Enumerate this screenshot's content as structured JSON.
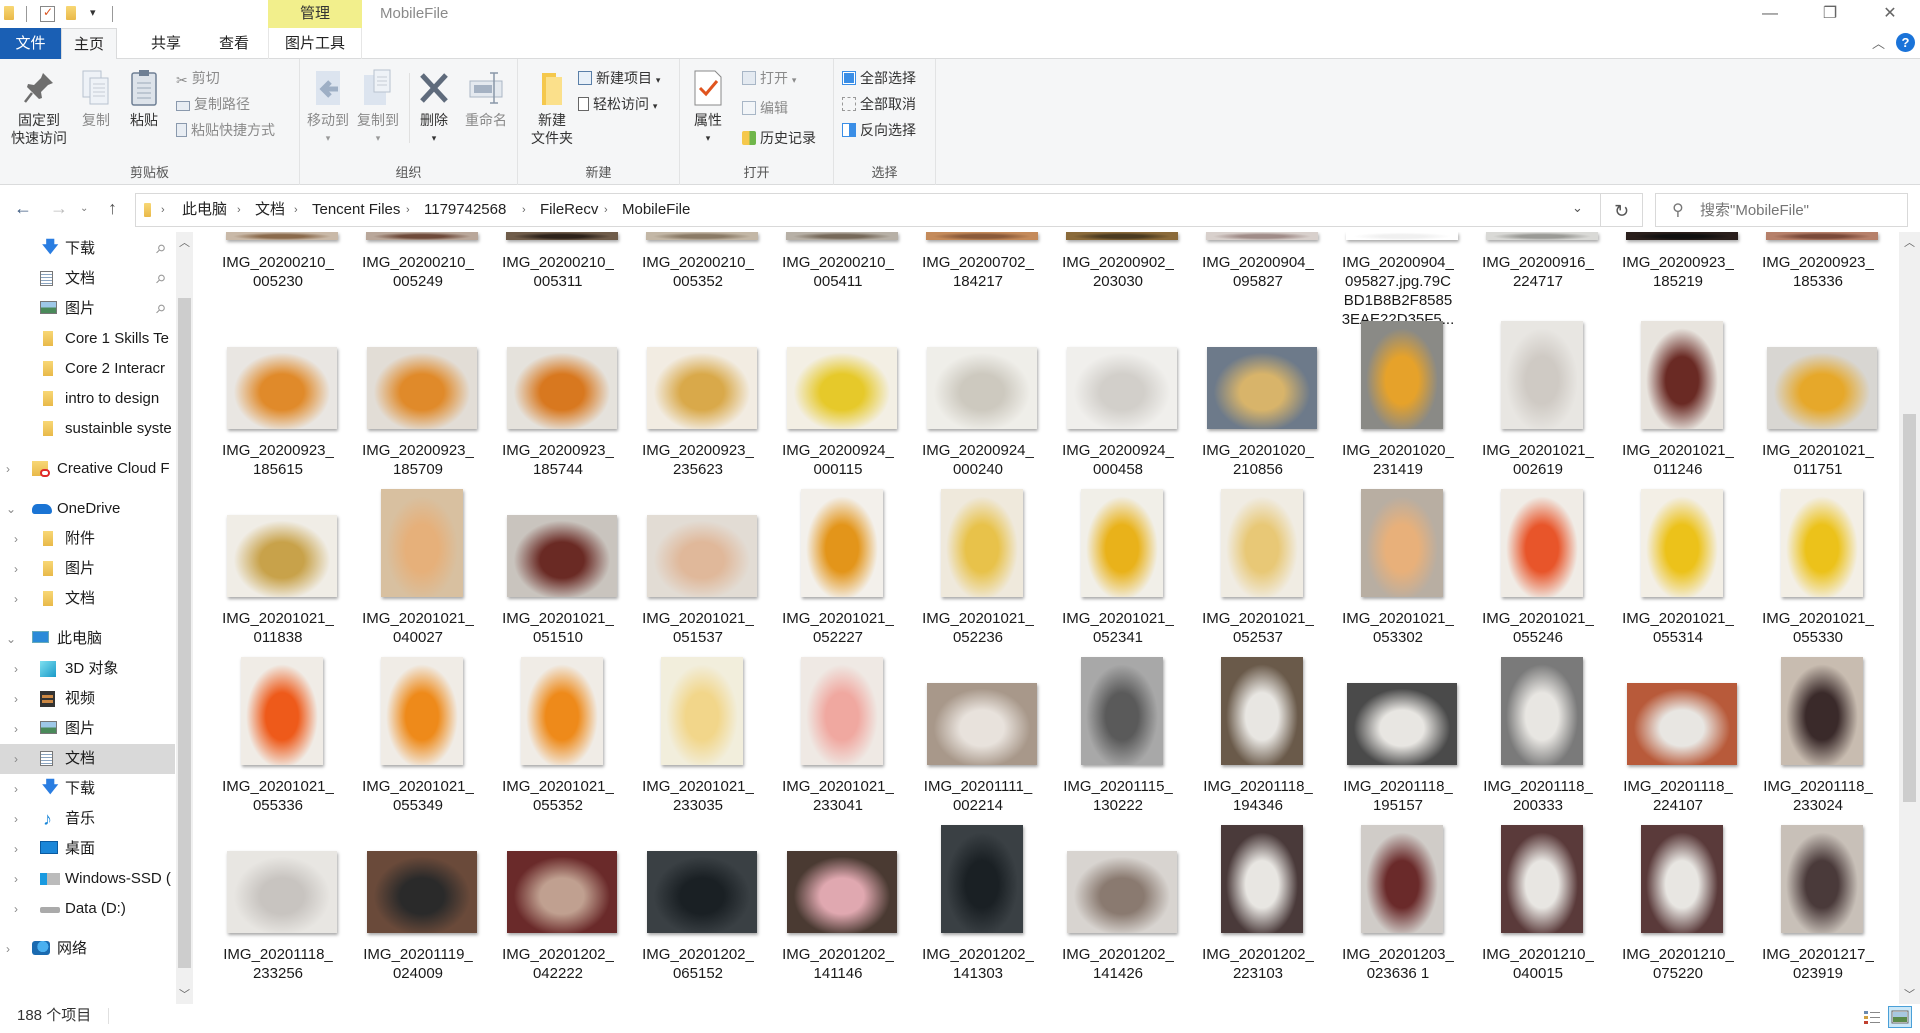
{
  "window": {
    "title": "MobileFile",
    "manage_tab": "管理",
    "min_glyph": "—",
    "max_glyph": "❐",
    "close_glyph": "✕"
  },
  "tabs": {
    "file": "文件",
    "home": "主页",
    "share": "共享",
    "view": "查看",
    "picture_tools": "图片工具"
  },
  "ribbon": {
    "clipboard": {
      "label": "剪贴板",
      "pin_line1": "固定到",
      "pin_line2": "快速访问",
      "copy": "复制",
      "paste": "粘贴",
      "cut": "剪切",
      "copy_path": "复制路径",
      "paste_shortcut": "粘贴快捷方式"
    },
    "organize": {
      "label": "组织",
      "move_to": "移动到",
      "copy_to": "复制到",
      "delete": "删除",
      "rename": "重命名"
    },
    "new": {
      "label": "新建",
      "new_folder_line1": "新建",
      "new_folder_line2": "文件夹",
      "new_item": "新建项目",
      "easy_access": "轻松访问"
    },
    "open": {
      "label": "打开",
      "properties": "属性",
      "open": "打开",
      "edit": "编辑",
      "history": "历史记录"
    },
    "select": {
      "label": "选择",
      "select_all": "全部选择",
      "select_none": "全部取消",
      "invert": "反向选择"
    }
  },
  "address": {
    "breadcrumbs": [
      "此电脑",
      "文档",
      "Tencent Files",
      "1179742568",
      "FileRecv",
      "MobileFile"
    ],
    "search_placeholder": "搜索\"MobileFile\""
  },
  "sidebar": {
    "items": [
      {
        "label": "下载",
        "icon": "download-icon",
        "pinned": true
      },
      {
        "label": "文档",
        "icon": "documents-icon",
        "pinned": true
      },
      {
        "label": "图片",
        "icon": "pictures-icon",
        "pinned": true
      },
      {
        "label": "Core 1 Skills Te",
        "icon": "folder-icon"
      },
      {
        "label": "Core 2 Interacr",
        "icon": "folder-icon"
      },
      {
        "label": "intro to design",
        "icon": "folder-icon"
      },
      {
        "label": "sustainble syste",
        "icon": "folder-icon"
      },
      {
        "label": "Creative Cloud F",
        "icon": "creative-cloud-icon"
      },
      {
        "label": "OneDrive",
        "icon": "onedrive-icon"
      },
      {
        "label": "附件",
        "icon": "folder-icon"
      },
      {
        "label": "图片",
        "icon": "folder-icon"
      },
      {
        "label": "文档",
        "icon": "folder-icon"
      },
      {
        "label": "此电脑",
        "icon": "this-pc-icon"
      },
      {
        "label": "3D 对象",
        "icon": "3d-objects-icon"
      },
      {
        "label": "视频",
        "icon": "videos-icon"
      },
      {
        "label": "图片",
        "icon": "pictures-icon"
      },
      {
        "label": "文档",
        "icon": "documents-icon",
        "selected": true
      },
      {
        "label": "下载",
        "icon": "download-icon"
      },
      {
        "label": "音乐",
        "icon": "music-icon"
      },
      {
        "label": "桌面",
        "icon": "desktop-icon"
      },
      {
        "label": "Windows-SSD (",
        "icon": "windows-drive-icon"
      },
      {
        "label": "Data (D:)",
        "icon": "drive-icon"
      },
      {
        "label": "网络",
        "icon": "network-icon"
      }
    ]
  },
  "files": [
    {
      "l1": "IMG_20200210_",
      "l2": "005230"
    },
    {
      "l1": "IMG_20200210_",
      "l2": "005249"
    },
    {
      "l1": "IMG_20200210_",
      "l2": "005311"
    },
    {
      "l1": "IMG_20200210_",
      "l2": "005352"
    },
    {
      "l1": "IMG_20200210_",
      "l2": "005411"
    },
    {
      "l1": "IMG_20200702_",
      "l2": "184217"
    },
    {
      "l1": "IMG_20200902_",
      "l2": "203030"
    },
    {
      "l1": "IMG_20200904_",
      "l2": "095827"
    },
    {
      "l1": "IMG_20200904_",
      "l2": "095827.jpg.79C",
      "l3": "BD1B8B2F8585",
      "l4": "3EAE22D35F5..."
    },
    {
      "l1": "IMG_20200916_",
      "l2": "224717"
    },
    {
      "l1": "IMG_20200923_",
      "l2": "185219"
    },
    {
      "l1": "IMG_20200923_",
      "l2": "185336"
    },
    {
      "l1": "IMG_20200923_",
      "l2": "185615"
    },
    {
      "l1": "IMG_20200923_",
      "l2": "185709"
    },
    {
      "l1": "IMG_20200923_",
      "l2": "185744"
    },
    {
      "l1": "IMG_20200923_",
      "l2": "235623"
    },
    {
      "l1": "IMG_20200924_",
      "l2": "000115"
    },
    {
      "l1": "IMG_20200924_",
      "l2": "000240"
    },
    {
      "l1": "IMG_20200924_",
      "l2": "000458"
    },
    {
      "l1": "IMG_20201020_",
      "l2": "210856"
    },
    {
      "l1": "IMG_20201020_",
      "l2": "231419"
    },
    {
      "l1": "IMG_20201021_",
      "l2": "002619"
    },
    {
      "l1": "IMG_20201021_",
      "l2": "011246"
    },
    {
      "l1": "IMG_20201021_",
      "l2": "011751"
    },
    {
      "l1": "IMG_20201021_",
      "l2": "011838"
    },
    {
      "l1": "IMG_20201021_",
      "l2": "040027"
    },
    {
      "l1": "IMG_20201021_",
      "l2": "051510"
    },
    {
      "l1": "IMG_20201021_",
      "l2": "051537"
    },
    {
      "l1": "IMG_20201021_",
      "l2": "052227"
    },
    {
      "l1": "IMG_20201021_",
      "l2": "052236"
    },
    {
      "l1": "IMG_20201021_",
      "l2": "052341"
    },
    {
      "l1": "IMG_20201021_",
      "l2": "052537"
    },
    {
      "l1": "IMG_20201021_",
      "l2": "053302"
    },
    {
      "l1": "IMG_20201021_",
      "l2": "055246"
    },
    {
      "l1": "IMG_20201021_",
      "l2": "055314"
    },
    {
      "l1": "IMG_20201021_",
      "l2": "055330"
    },
    {
      "l1": "IMG_20201021_",
      "l2": "055336"
    },
    {
      "l1": "IMG_20201021_",
      "l2": "055349"
    },
    {
      "l1": "IMG_20201021_",
      "l2": "055352"
    },
    {
      "l1": "IMG_20201021_",
      "l2": "233035"
    },
    {
      "l1": "IMG_20201021_",
      "l2": "233041"
    },
    {
      "l1": "IMG_20201111_",
      "l2": "002214"
    },
    {
      "l1": "IMG_20201115_",
      "l2": "130222"
    },
    {
      "l1": "IMG_20201118_",
      "l2": "194346"
    },
    {
      "l1": "IMG_20201118_",
      "l2": "195157"
    },
    {
      "l1": "IMG_20201118_",
      "l2": "200333"
    },
    {
      "l1": "IMG_20201118_",
      "l2": "224107"
    },
    {
      "l1": "IMG_20201118_",
      "l2": "233024"
    },
    {
      "l1": "IMG_20201118_",
      "l2": "233256"
    },
    {
      "l1": "IMG_20201119_",
      "l2": "024009"
    },
    {
      "l1": "IMG_20201202_",
      "l2": "042222"
    },
    {
      "l1": "IMG_20201202_",
      "l2": "065152"
    },
    {
      "l1": "IMG_20201202_",
      "l2": "141146"
    },
    {
      "l1": "IMG_20201202_",
      "l2": "141303"
    },
    {
      "l1": "IMG_20201202_",
      "l2": "141426"
    },
    {
      "l1": "IMG_20201202_",
      "l2": "223103"
    },
    {
      "l1": "IMG_20201203_",
      "l2": "023636 1"
    },
    {
      "l1": "IMG_20201210_",
      "l2": "040015"
    },
    {
      "l1": "IMG_20201210_",
      "l2": "075220"
    },
    {
      "l1": "IMG_20201217_",
      "l2": "023919"
    }
  ],
  "thumb_colors": [
    [
      "#c9b9a8",
      "#8a6a4c"
    ],
    [
      "#b9a79a",
      "#6e4a3a"
    ],
    [
      "#6f5c4a",
      "#2d221a"
    ],
    [
      "#c3b7a6",
      "#8a7a66"
    ],
    [
      "#b7b0a6",
      "#76695a"
    ],
    [
      "#c48a5a",
      "#8a5a3a"
    ],
    [
      "#8a6a3a",
      "#4a3a20"
    ],
    [
      "#d8d0cc",
      "#a08c88"
    ],
    [
      "#ffffff",
      "#f0f0f0"
    ],
    [
      "#d9d9d6",
      "#9a9a96"
    ],
    [
      "#2a1f1c",
      "#101010"
    ],
    [
      "#b6806a",
      "#7a4a3a"
    ],
    [
      "#e9e6e2",
      "#e08a2a"
    ],
    [
      "#e2ddd6",
      "#e08a2a"
    ],
    [
      "#e5e2dc",
      "#d8781f"
    ],
    [
      "#f2ece2",
      "#d9a94a"
    ],
    [
      "#f3efe4",
      "#e6c92a"
    ],
    [
      "#efeee9",
      "#cdc9bf"
    ],
    [
      "#f0efec",
      "#d2cfca"
    ],
    [
      "#6d7a8a",
      "#d8b46a"
    ],
    [
      "#8a8a86",
      "#e6a22a"
    ],
    [
      "#e8e6e2",
      "#cfcac4"
    ],
    [
      "#e8e4de",
      "#6a2a24"
    ],
    [
      "#d8d6d2",
      "#e6a82a"
    ],
    [
      "#f0ede6",
      "#c8a24a"
    ],
    [
      "#d8c0a0",
      "#e6b07a"
    ],
    [
      "#c9c4be",
      "#6a2a24"
    ],
    [
      "#e2dcd4",
      "#e0b89a"
    ],
    [
      "#f3f0eb",
      "#e3951a"
    ],
    [
      "#efe9dc",
      "#e8c24a"
    ],
    [
      "#f1efe8",
      "#e9b21a"
    ],
    [
      "#f0ece3",
      "#e8c876"
    ],
    [
      "#b8aea2",
      "#e8b07a"
    ],
    [
      "#f0ece6",
      "#e8552a"
    ],
    [
      "#f3efe6",
      "#ecc21a"
    ],
    [
      "#f3efe6",
      "#ecc21a"
    ],
    [
      "#f0ece6",
      "#ee5a1a"
    ],
    [
      "#f0ece6",
      "#ee8a1a"
    ],
    [
      "#f0ece6",
      "#ee8a1a"
    ],
    [
      "#f2eedc",
      "#f2d68a"
    ],
    [
      "#efe9e4",
      "#f0a8a0"
    ],
    [
      "#a8988a",
      "#e8e2dc"
    ],
    [
      "#a8a8a8",
      "#5a5a5a"
    ],
    [
      "#6a5a4a",
      "#e8e6e2"
    ],
    [
      "#4a4a4a",
      "#e8e6e2"
    ],
    [
      "#7a7a7a",
      "#e8e6e2"
    ],
    [
      "#b85a3a",
      "#e8e6e2"
    ],
    [
      "#c8bcb0",
      "#3a2a2a"
    ],
    [
      "#e8e6e2",
      "#c8c4c0"
    ],
    [
      "#6a4a3a",
      "#2a2a2a"
    ],
    [
      "#6a2a2a",
      "#c0a090"
    ],
    [
      "#3a4044",
      "#1a2024"
    ],
    [
      "#4a3a32",
      "#e0a8b0"
    ],
    [
      "#3a4044",
      "#1a2024"
    ],
    [
      "#d8d4d0",
      "#8a7a70"
    ],
    [
      "#4a3a3a",
      "#e8e6e2"
    ],
    [
      "#d0ccc8",
      "#6a2a2a"
    ],
    [
      "#5a3a3a",
      "#e8e6e2"
    ],
    [
      "#5a3a3a",
      "#e8e6e2"
    ],
    [
      "#c8c0b8",
      "#4a3a3a"
    ]
  ],
  "status": {
    "item_count": "188 个项目"
  }
}
